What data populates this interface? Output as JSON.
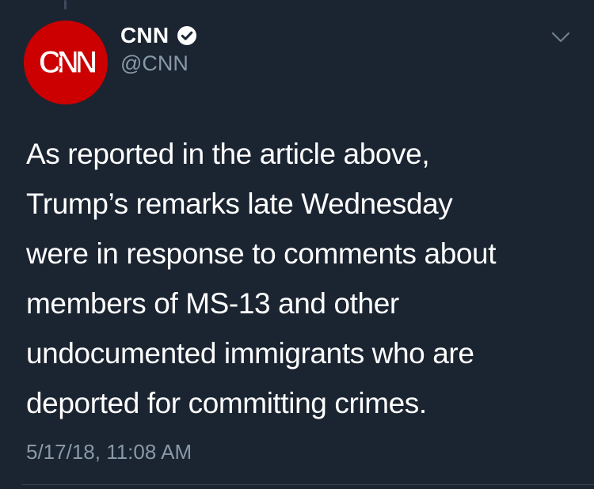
{
  "tweet": {
    "author": {
      "display_name": "CNN",
      "handle": "@CNN",
      "verified": true,
      "avatar_logo_text": "CNN",
      "avatar_color": "#cc0000"
    },
    "text_lines": [
      "As reported in the article above,",
      "Trump’s remarks late Wednesday",
      "were in response to comments about",
      "members of MS-13 and other",
      "undocumented immigrants who are",
      "deported for committing crimes."
    ],
    "timestamp": "5/17/18, 11:08 AM",
    "icons": {
      "verified": "verified-badge-icon",
      "menu": "chevron-down-icon"
    }
  },
  "theme": {
    "background": "#1b2431",
    "text_primary": "#ffffff",
    "text_secondary": "#8899a6",
    "divider": "#38444d"
  }
}
